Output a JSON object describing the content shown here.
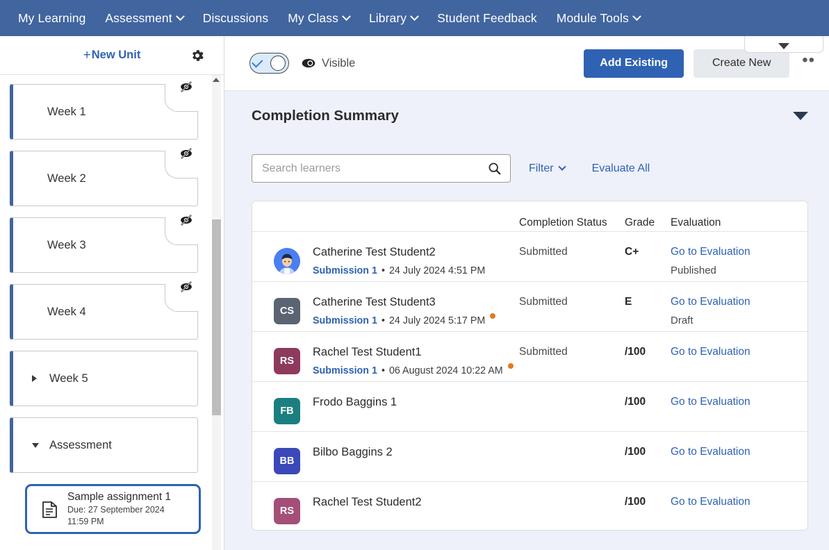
{
  "topnav": {
    "items": [
      {
        "label": "My Learning",
        "caret": false
      },
      {
        "label": "Assessment",
        "caret": true
      },
      {
        "label": "Discussions",
        "caret": false
      },
      {
        "label": "My Class",
        "caret": true
      },
      {
        "label": "Library",
        "caret": true
      },
      {
        "label": "Student Feedback",
        "caret": false
      },
      {
        "label": "Module Tools",
        "caret": true
      }
    ]
  },
  "sidebar": {
    "new_unit_label": "New Unit",
    "new_unit_plus": "+",
    "units": [
      {
        "label": "Week 1",
        "hidden_icon": true,
        "caret": "none"
      },
      {
        "label": "Week 2",
        "hidden_icon": true,
        "caret": "none"
      },
      {
        "label": "Week 3",
        "hidden_icon": true,
        "caret": "none"
      },
      {
        "label": "Week 4",
        "hidden_icon": true,
        "caret": "none"
      },
      {
        "label": "Week 5",
        "hidden_icon": false,
        "caret": "right"
      },
      {
        "label": "Assessment",
        "hidden_icon": false,
        "caret": "down"
      }
    ],
    "assignment": {
      "title": "Sample assignment 1",
      "due_line1": "Due: 27 September 2024",
      "due_line2": "11:59 PM"
    }
  },
  "toolbar": {
    "visible_label": "Visible",
    "add_existing_label": "Add Existing",
    "create_new_label": "Create New",
    "more_label": "••"
  },
  "main": {
    "section_title": "Completion Summary",
    "search_placeholder": "Search learners",
    "search_value": "",
    "filter_label": "Filter",
    "evaluate_all_label": "Evaluate All",
    "columns": {
      "name": "",
      "status": "Completion Status",
      "grade": "Grade",
      "evaluation": "Evaluation"
    },
    "rows": [
      {
        "avatar_type": "photo",
        "avatar_initials": "",
        "avatar_color": "#4b7ef0",
        "name": "Catherine Test Student2",
        "submission_label": "Submission 1",
        "separator": "•",
        "submission_date": "24 July 2024 4:51 PM",
        "warning_dot": false,
        "status": "Submitted",
        "grade": "C+",
        "eval_link": "Go to Evaluation",
        "eval_state": "Published"
      },
      {
        "avatar_type": "initials",
        "avatar_initials": "CS",
        "avatar_color": "#5a6472",
        "name": "Catherine Test Student3",
        "submission_label": "Submission 1",
        "separator": "•",
        "submission_date": "24 July 2024 5:17 PM",
        "warning_dot": true,
        "status": "Submitted",
        "grade": "E",
        "eval_link": "Go to Evaluation",
        "eval_state": "Draft"
      },
      {
        "avatar_type": "initials",
        "avatar_initials": "RS",
        "avatar_color": "#8e3a5c",
        "name": "Rachel Test Student1",
        "submission_label": "Submission 1",
        "separator": "•",
        "submission_date": "06 August 2024 10:22 AM",
        "warning_dot": true,
        "status": "Submitted",
        "grade": "/100",
        "eval_link": "Go to Evaluation",
        "eval_state": ""
      },
      {
        "avatar_type": "initials",
        "avatar_initials": "FB",
        "avatar_color": "#1b7f80",
        "name": "Frodo Baggins 1",
        "submission_label": "",
        "separator": "",
        "submission_date": "",
        "warning_dot": false,
        "status": "",
        "grade": "/100",
        "eval_link": "Go to Evaluation",
        "eval_state": ""
      },
      {
        "avatar_type": "initials",
        "avatar_initials": "BB",
        "avatar_color": "#3b48b8",
        "name": "Bilbo Baggins 2",
        "submission_label": "",
        "separator": "",
        "submission_date": "",
        "warning_dot": false,
        "status": "",
        "grade": "/100",
        "eval_link": "Go to Evaluation",
        "eval_state": ""
      },
      {
        "avatar_type": "initials",
        "avatar_initials": "RS",
        "avatar_color": "#a34f77",
        "name": "Rachel Test Student2",
        "submission_label": "",
        "separator": "",
        "submission_date": "",
        "warning_dot": false,
        "status": "",
        "grade": "/100",
        "eval_link": "Go to Evaluation",
        "eval_state": ""
      }
    ]
  },
  "colors": {
    "nav_blue": "#41659f",
    "accent_blue": "#2f62b3",
    "content_bg": "#eef1fa",
    "warning_orange": "#e07b20"
  }
}
